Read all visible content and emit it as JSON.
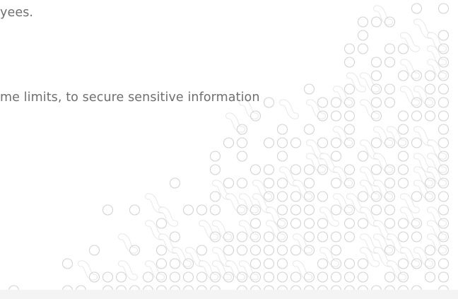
{
  "content": {
    "line1": "yees.",
    "line2": "me limits, to secure sensitive information"
  },
  "decoration": {
    "name": "dot-link-pattern",
    "stroke_color": "#d4d4d4"
  }
}
